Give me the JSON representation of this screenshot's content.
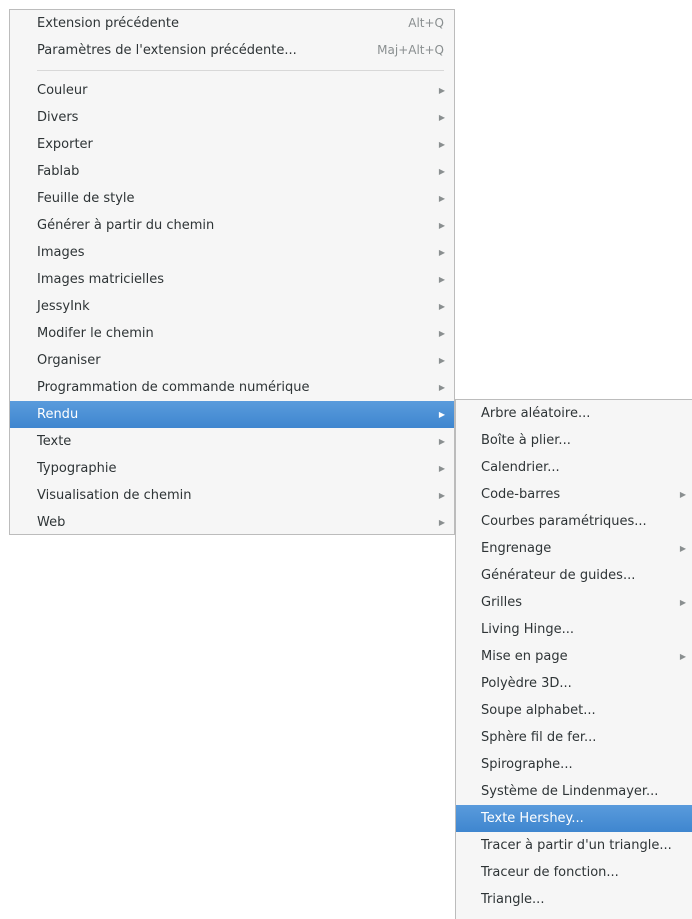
{
  "main_menu": {
    "top_items": [
      {
        "label": "Extension précédente",
        "accel": "Alt+Q"
      },
      {
        "label": "Paramètres de l'extension précédente...",
        "accel": "Maj+Alt+Q"
      }
    ],
    "items": [
      {
        "label": "Couleur",
        "has_submenu": true,
        "selected": false
      },
      {
        "label": "Divers",
        "has_submenu": true,
        "selected": false
      },
      {
        "label": "Exporter",
        "has_submenu": true,
        "selected": false
      },
      {
        "label": "Fablab",
        "has_submenu": true,
        "selected": false
      },
      {
        "label": "Feuille de style",
        "has_submenu": true,
        "selected": false
      },
      {
        "label": "Générer à partir du chemin",
        "has_submenu": true,
        "selected": false
      },
      {
        "label": "Images",
        "has_submenu": true,
        "selected": false
      },
      {
        "label": "Images matricielles",
        "has_submenu": true,
        "selected": false
      },
      {
        "label": "JessyInk",
        "has_submenu": true,
        "selected": false
      },
      {
        "label": "Modifer le chemin",
        "has_submenu": true,
        "selected": false
      },
      {
        "label": "Organiser",
        "has_submenu": true,
        "selected": false
      },
      {
        "label": "Programmation de commande numérique",
        "has_submenu": true,
        "selected": false
      },
      {
        "label": "Rendu",
        "has_submenu": true,
        "selected": true
      },
      {
        "label": "Texte",
        "has_submenu": true,
        "selected": false
      },
      {
        "label": "Typographie",
        "has_submenu": true,
        "selected": false
      },
      {
        "label": "Visualisation de chemin",
        "has_submenu": true,
        "selected": false
      },
      {
        "label": "Web",
        "has_submenu": true,
        "selected": false
      }
    ]
  },
  "sub_menu": {
    "items": [
      {
        "label": "Arbre aléatoire...",
        "has_submenu": false,
        "selected": false
      },
      {
        "label": "Boîte à plier...",
        "has_submenu": false,
        "selected": false
      },
      {
        "label": "Calendrier...",
        "has_submenu": false,
        "selected": false
      },
      {
        "label": "Code-barres",
        "has_submenu": true,
        "selected": false
      },
      {
        "label": "Courbes paramétriques...",
        "has_submenu": false,
        "selected": false
      },
      {
        "label": "Engrenage",
        "has_submenu": true,
        "selected": false
      },
      {
        "label": "Générateur de guides...",
        "has_submenu": false,
        "selected": false
      },
      {
        "label": "Grilles",
        "has_submenu": true,
        "selected": false
      },
      {
        "label": "Living Hinge...",
        "has_submenu": false,
        "selected": false
      },
      {
        "label": "Mise en page",
        "has_submenu": true,
        "selected": false
      },
      {
        "label": "Polyèdre 3D...",
        "has_submenu": false,
        "selected": false
      },
      {
        "label": "Soupe alphabet...",
        "has_submenu": false,
        "selected": false
      },
      {
        "label": "Sphère fil de fer...",
        "has_submenu": false,
        "selected": false
      },
      {
        "label": "Spirographe...",
        "has_submenu": false,
        "selected": false
      },
      {
        "label": "Système de Lindenmayer...",
        "has_submenu": false,
        "selected": false
      },
      {
        "label": "Texte Hershey...",
        "has_submenu": false,
        "selected": true
      },
      {
        "label": "Tracer à partir d'un triangle...",
        "has_submenu": false,
        "selected": false
      },
      {
        "label": "Traceur de fonction...",
        "has_submenu": false,
        "selected": false
      },
      {
        "label": "Triangle...",
        "has_submenu": false,
        "selected": false
      }
    ]
  },
  "icons": {
    "submenu_arrow": "▶"
  },
  "colors": {
    "selection": "#4a90d9",
    "menu_bg": "#f6f6f6"
  }
}
